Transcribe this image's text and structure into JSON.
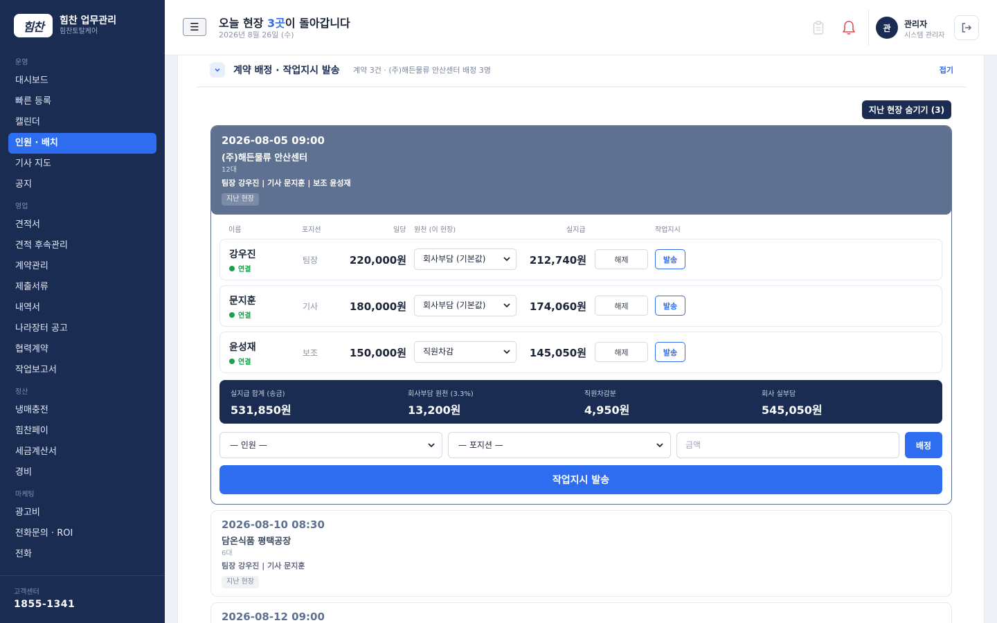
{
  "brand": {
    "logo": "힘찬",
    "name": "힘찬 업무관리",
    "sub": "힘찬토탈케어"
  },
  "sidebar": {
    "sections": [
      {
        "label": "운영",
        "items": [
          "대시보드",
          "빠른 등록",
          "캘린더",
          "인원 · 배치",
          "기사 지도",
          "공지"
        ]
      },
      {
        "label": "영업",
        "items": [
          "견적서",
          "견적 후속관리",
          "계약관리",
          "제출서류",
          "내역서",
          "나라장터 공고",
          "협력계약",
          "작업보고서"
        ]
      },
      {
        "label": "정산",
        "items": [
          "냉매충전",
          "힘찬페이",
          "세금계산서",
          "경비"
        ]
      },
      {
        "label": "마케팅",
        "items": [
          "광고비",
          "전화문의 · ROI",
          "전화"
        ]
      }
    ],
    "active": "인원 · 배치",
    "footer_label": "고객센터",
    "footer_phone": "1855-1341"
  },
  "topbar": {
    "menu_icon": "hamburger-icon",
    "title_pre": "오늘 현장 ",
    "title_accent": "3곳",
    "title_post": "이 돌아갑니다",
    "date": "2026년 8월 26일 (수)",
    "user_initial": "관",
    "user_name": "관리자",
    "user_role": "시스템 관리자"
  },
  "section": {
    "title": "계약 배정 · 작업지시 발송",
    "subtitle": "계약 3건 · (주)해든물류 안산센터 배정 3명",
    "collapse": "접기",
    "hide_past": "지난 현장 숨기기 (3)"
  },
  "job_expanded": {
    "date": "2026-08-05 09:00",
    "site": "(주)해든물류 안산센터",
    "vehicles": "12대",
    "crew": "팀장 강우진 | 기사 문지훈 | 보조 윤성재",
    "badge": "지난 현장",
    "columns": [
      "이름",
      "포지션",
      "일당",
      "원천 (이 현장)",
      "실지급",
      "작업지시"
    ],
    "rows": [
      {
        "name": "강우진",
        "status": "연결",
        "position": "팀장",
        "rate": "220,000원",
        "withholding": "회사부담 (기본값)",
        "net": "212,740원",
        "release": "해제",
        "send": "발송"
      },
      {
        "name": "문지훈",
        "status": "연결",
        "position": "기사",
        "rate": "180,000원",
        "withholding": "회사부담 (기본값)",
        "net": "174,060원",
        "release": "해제",
        "send": "발송"
      },
      {
        "name": "윤성재",
        "status": "연결",
        "position": "보조",
        "rate": "150,000원",
        "withholding": "직원차감",
        "net": "145,050원",
        "release": "해제",
        "send": "발송"
      }
    ],
    "summary": [
      {
        "label": "실지급 합계 (송금)",
        "value": "531,850원"
      },
      {
        "label": "회사부담 원천 (3.3%)",
        "value": "13,200원"
      },
      {
        "label": "직원차감분",
        "value": "4,950원"
      },
      {
        "label": "회사 실부담",
        "value": "545,050원"
      }
    ],
    "assign": {
      "person": "— 인원 —",
      "position": "— 포지션 —",
      "amount_placeholder": "금액",
      "button": "배정"
    },
    "dispatch": "작업지시 발송"
  },
  "jobs": [
    {
      "date": "2026-08-10 08:30",
      "site": "담온식품 평택공장",
      "vehicles": "6대",
      "crew": "팀장 강우진 | 기사 문지훈",
      "badge": "지난 현장"
    },
    {
      "date": "2026-08-12 09:00",
      "site": "",
      "vehicles": "",
      "crew": "",
      "badge": ""
    }
  ],
  "colors": {
    "sidebar": "#1a2c52",
    "accent": "#2f6df0",
    "job_header": "#5e7190",
    "status_green": "#16a34a"
  }
}
